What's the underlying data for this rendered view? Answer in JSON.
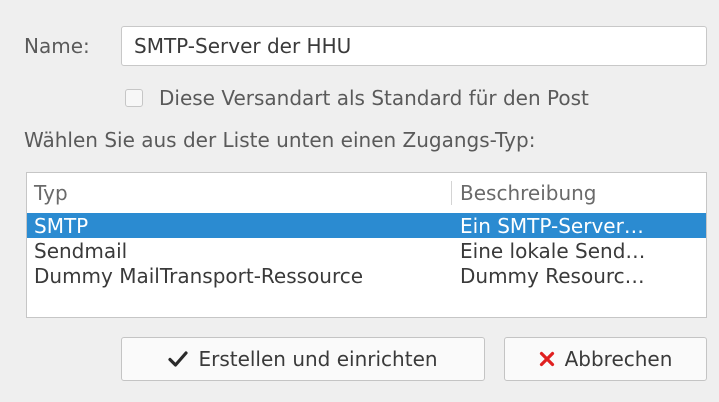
{
  "form": {
    "name_label": "Name:",
    "name_value": "SMTP-Server der HHU",
    "default_checkbox_label": "Diese Versandart als Standard für den Post",
    "default_checkbox_checked": false,
    "instruction": "Wählen Sie aus der Liste unten einen Zugangs-Typ:"
  },
  "list": {
    "columns": [
      "Typ",
      "Beschreibung"
    ],
    "rows": [
      {
        "typ": "SMTP",
        "beschreibung": "Ein SMTP-Server…",
        "selected": true
      },
      {
        "typ": "Sendmail",
        "beschreibung": "Eine lokale Send…",
        "selected": false
      },
      {
        "typ": "Dummy MailTransport-Ressource",
        "beschreibung": "Dummy Resourc…",
        "selected": false
      }
    ]
  },
  "buttons": {
    "create_label": "Erstellen und einrichten",
    "cancel_label": "Abbrechen",
    "create_icon": "checkmark-icon",
    "cancel_icon": "x-icon"
  },
  "colors": {
    "selection": "#2b8bd1",
    "cancel_icon": "#e02020",
    "background": "#efefef"
  }
}
